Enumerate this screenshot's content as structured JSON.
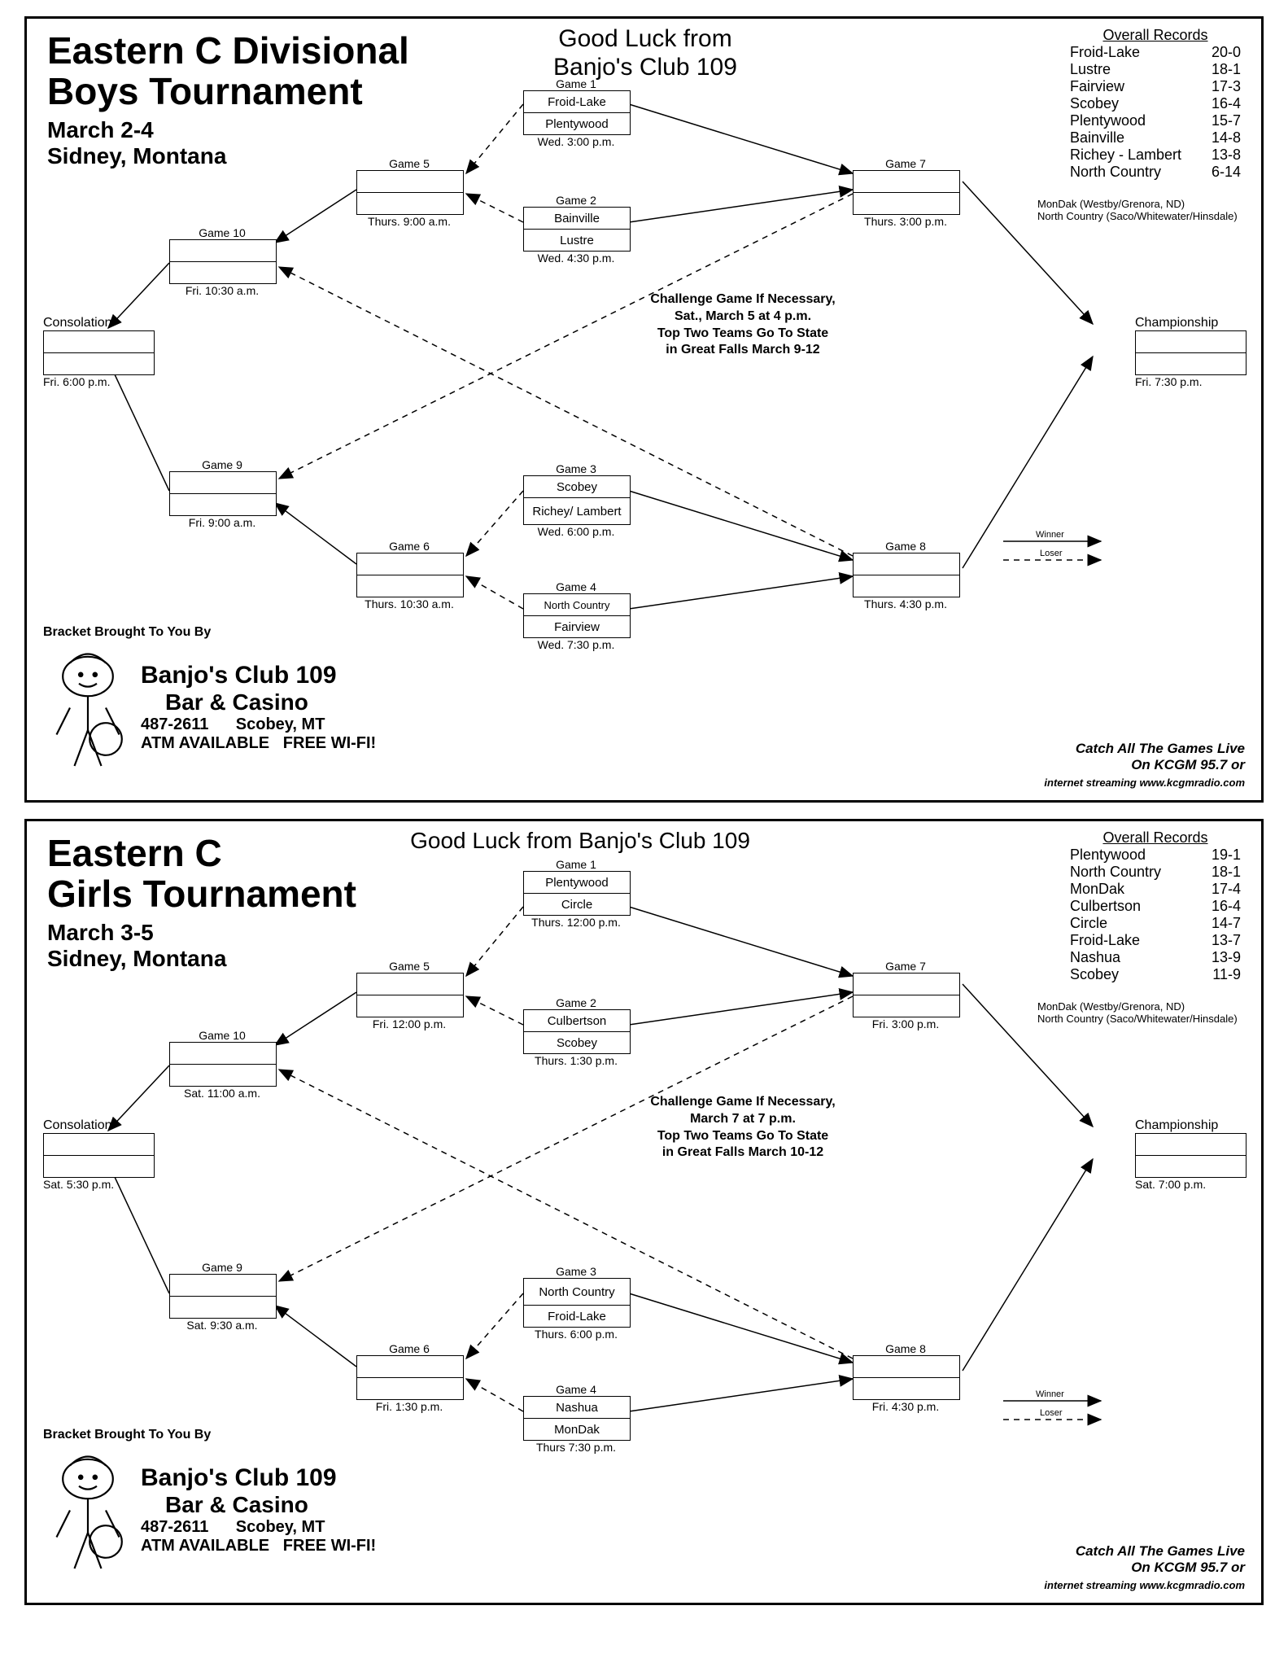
{
  "boys": {
    "title1": "Eastern C Divisional",
    "title2": "Boys Tournament",
    "dates": "March 2-4",
    "location": "Sidney, Montana",
    "goodluck1": "Good Luck from",
    "goodluck2": "Banjo's Club 109",
    "records_head": "Overall Records",
    "records": [
      {
        "team": "Froid-Lake",
        "rec": "20-0"
      },
      {
        "team": "Lustre",
        "rec": "18-1"
      },
      {
        "team": "Fairview",
        "rec": "17-3"
      },
      {
        "team": "Scobey",
        "rec": "16-4"
      },
      {
        "team": "Plentywood",
        "rec": "15-7"
      },
      {
        "team": "Bainville",
        "rec": "14-8"
      },
      {
        "team": "Richey - Lambert",
        "rec": "13-8"
      },
      {
        "team": "North Country",
        "rec": "6-14"
      }
    ],
    "note1": "MonDak (Westby/Grenora, ND)",
    "note2": "North Country (Saco/Whitewater/Hinsdale)",
    "midnote": "Challenge Game If Necessary,\nSat., March 5 at 4 p.m.\nTop Two Teams Go To State\nin Great Falls March 9-12",
    "g1": {
      "label": "Game 1",
      "t1": "Froid-Lake",
      "t2": "Plentywood",
      "time": "Wed. 3:00 p.m."
    },
    "g2": {
      "label": "Game 2",
      "t1": "Bainville",
      "t2": "Lustre",
      "time": "Wed. 4:30 p.m."
    },
    "g3": {
      "label": "Game 3",
      "t1": "Scobey",
      "t2": "Richey/ Lambert",
      "time": "Wed. 6:00 p.m."
    },
    "g4": {
      "label": "Game 4",
      "t1": "North Country",
      "t2": "Fairview",
      "time": "Wed. 7:30 p.m."
    },
    "g5": {
      "label": "Game 5",
      "time": "Thurs. 9:00 a.m."
    },
    "g6": {
      "label": "Game 6",
      "time": "Thurs. 10:30 a.m."
    },
    "g7": {
      "label": "Game 7",
      "time": "Thurs. 3:00 p.m."
    },
    "g8": {
      "label": "Game 8",
      "time": "Thurs. 4:30 p.m."
    },
    "g9": {
      "label": "Game 9",
      "time": "Fri. 9:00 a.m."
    },
    "g10": {
      "label": "Game 10",
      "time": "Fri. 10:30 a.m."
    },
    "cons": {
      "label": "Consolation",
      "time": "Fri. 6:00 p.m."
    },
    "champ": {
      "label": "Championship",
      "time": "Fri. 7:30 p.m."
    },
    "legend_w": "Winner",
    "legend_l": "Loser",
    "bracket_by": "Bracket Brought To You By",
    "sponsor_name": "Banjo's Club 109",
    "sponsor_sub": "Bar & Casino",
    "sponsor_phone": "487-2611",
    "sponsor_city": "Scobey, MT",
    "sponsor_atm": "ATM AVAILABLE",
    "sponsor_wifi": "FREE  WI-FI!",
    "live1": "Catch All The Games Live",
    "live2": "On KCGM 95.7 or",
    "live3": "internet streaming  www.kcgmradio.com"
  },
  "girls": {
    "title1": "Eastern C",
    "title2": "Girls Tournament",
    "dates": "March 3-5",
    "location": "Sidney, Montana",
    "goodluck": "Good Luck from Banjo's Club 109",
    "records_head": "Overall Records",
    "records": [
      {
        "team": "Plentywood",
        "rec": "19-1"
      },
      {
        "team": "North Country",
        "rec": "18-1"
      },
      {
        "team": "MonDak",
        "rec": "17-4"
      },
      {
        "team": "Culbertson",
        "rec": "16-4"
      },
      {
        "team": "Circle",
        "rec": "14-7"
      },
      {
        "team": "Froid-Lake",
        "rec": "13-7"
      },
      {
        "team": "Nashua",
        "rec": "13-9"
      },
      {
        "team": "Scobey",
        "rec": "11-9"
      }
    ],
    "note1": "MonDak (Westby/Grenora, ND)",
    "note2": "North Country (Saco/Whitewater/Hinsdale)",
    "midnote": "Challenge Game If Necessary,\nMarch 7 at 7 p.m.\nTop Two Teams Go To State\nin Great Falls March 10-12",
    "g1": {
      "label": "Game 1",
      "t1": "Plentywood",
      "t2": "Circle",
      "time": "Thurs. 12:00 p.m."
    },
    "g2": {
      "label": "Game 2",
      "t1": "Culbertson",
      "t2": "Scobey",
      "time": "Thurs. 1:30 p.m."
    },
    "g3": {
      "label": "Game 3",
      "t1": "North Country",
      "t2": "Froid-Lake",
      "time": "Thurs. 6:00 p.m."
    },
    "g4": {
      "label": "Game 4",
      "t1": "Nashua",
      "t2": "MonDak",
      "time": "Thurs  7:30 p.m."
    },
    "g5": {
      "label": "Game 5",
      "time": "Fri. 12:00 p.m."
    },
    "g6": {
      "label": "Game 6",
      "time": "Fri. 1:30 p.m."
    },
    "g7": {
      "label": "Game 7",
      "time": "Fri. 3:00 p.m."
    },
    "g8": {
      "label": "Game 8",
      "time": "Fri. 4:30 p.m."
    },
    "g9": {
      "label": "Game 9",
      "time": "Sat. 9:30 a.m."
    },
    "g10": {
      "label": "Game 10",
      "time": "Sat. 11:00 a.m."
    },
    "cons": {
      "label": "Consolation",
      "time": "Sat. 5:30 p.m."
    },
    "champ": {
      "label": "Championship",
      "time": "Sat. 7:00 p.m."
    },
    "legend_w": "Winner",
    "legend_l": "Loser",
    "bracket_by": "Bracket Brought To You By",
    "sponsor_name": "Banjo's Club 109",
    "sponsor_sub": "Bar & Casino",
    "sponsor_phone": "487-2611",
    "sponsor_city": "Scobey, MT",
    "sponsor_atm": "ATM AVAILABLE",
    "sponsor_wifi": "FREE  WI-FI!",
    "live1": "Catch All The Games Live",
    "live2": "On KCGM 95.7 or",
    "live3": "internet streaming  www.kcgmradio.com"
  }
}
